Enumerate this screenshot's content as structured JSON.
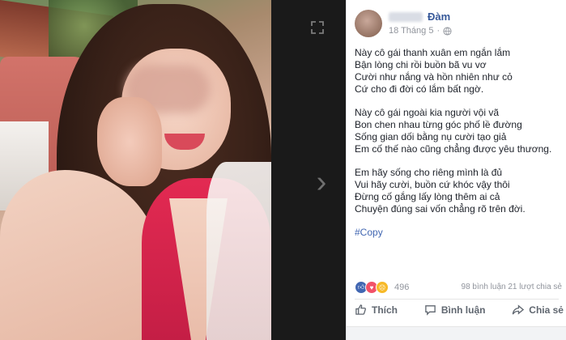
{
  "post": {
    "author_name": "Đàm",
    "date": "18 Tháng 5",
    "stanzas": [
      [
        "Này cô gái thanh xuân em ngắn lắm",
        "Bận lòng chi rồi buồn bã vu vơ",
        "Cười như nắng và hồn nhiên như cỏ",
        "Cứ cho đi đời có lắm bất ngờ."
      ],
      [
        "Này cô gái ngoài kia người vội vã",
        "Bon chen nhau từng góc phố lề đường",
        "Sống gian dối bằng nụ cười tạo giả",
        "Em cố thế nào cũng chẳng được yêu thương."
      ],
      [
        "Em hãy sống cho riêng mình là đủ",
        "Vui hãy cười, buồn cứ khóc vậy thôi",
        "Đừng cố gắng lấy lòng thêm ai cả",
        "Chuyện đúng sai vốn chẳng rõ trên đời."
      ]
    ],
    "hashtag": "#Copy",
    "reaction_count": "496",
    "comments": "98 bình luận",
    "shares": "21 lượt chia sẻ",
    "actions": {
      "like": "Thích",
      "comment": "Bình luận",
      "share": "Chia sẻ"
    }
  },
  "colors": {
    "link": "#365899",
    "hashtag": "#4267b2",
    "like": "#4267b2",
    "love": "#f25268",
    "haha": "#f7b928"
  }
}
